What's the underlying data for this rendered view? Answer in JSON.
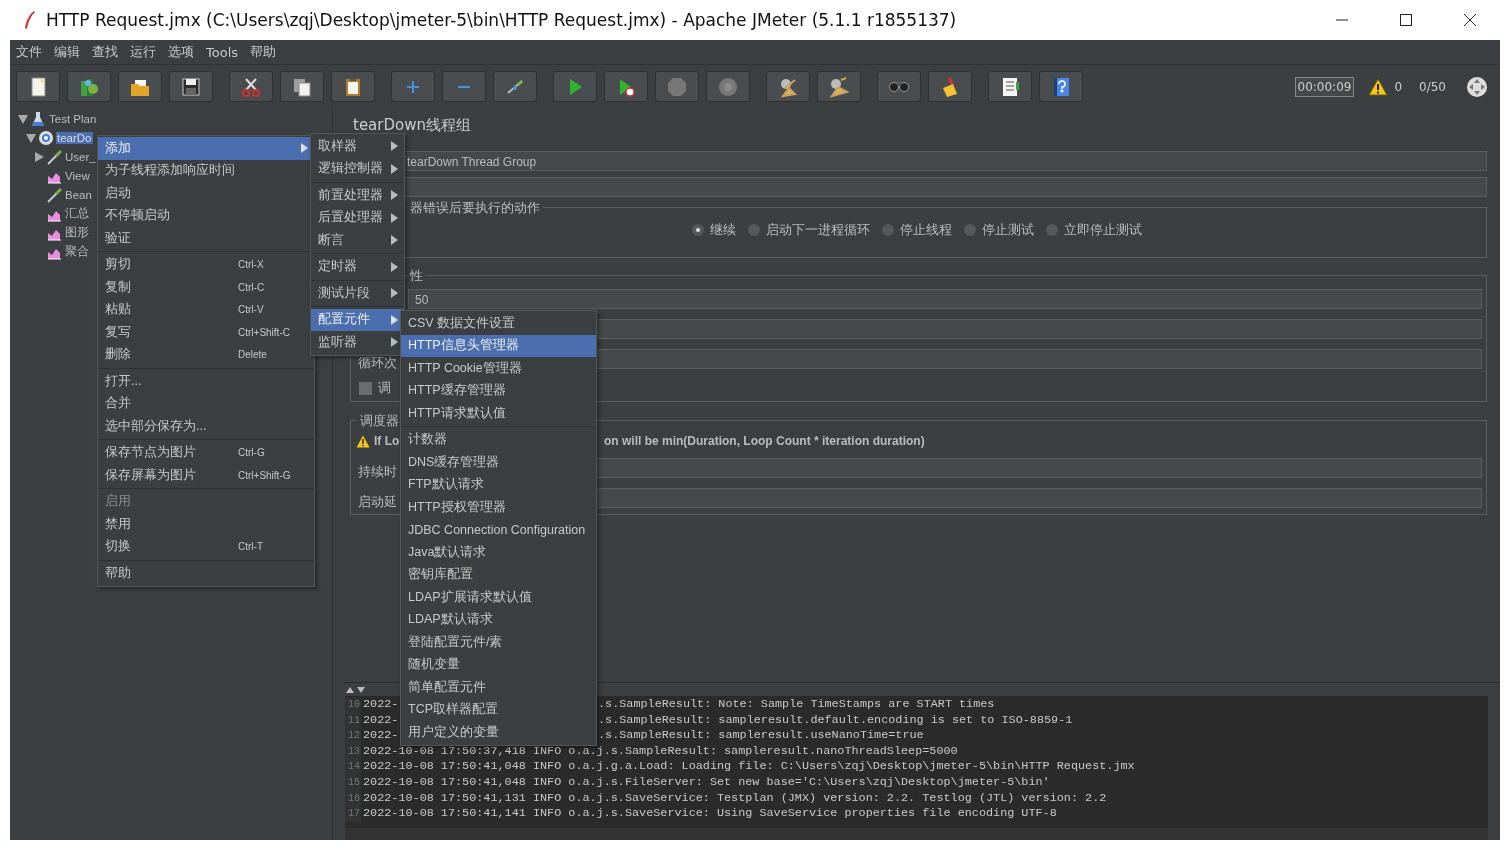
{
  "window": {
    "title": "HTTP Request.jmx (C:\\Users\\zqj\\Desktop\\jmeter-5\\bin\\HTTP Request.jmx) - Apache JMeter (5.1.1 r1855137)"
  },
  "menubar": [
    "文件",
    "编辑",
    "查找",
    "运行",
    "选项",
    "Tools",
    "帮助"
  ],
  "status": {
    "timer": "00:00:09",
    "warnings": "0",
    "threads": "0/50"
  },
  "tree": [
    {
      "label": "Test Plan",
      "kind": "plan",
      "expanded": true,
      "selected": false,
      "children": [
        {
          "label": "tearDo",
          "kind": "thread-group",
          "expanded": true,
          "selected": true,
          "children": [
            {
              "label": "User_",
              "kind": "pipette",
              "expanded": false,
              "selected": false
            },
            {
              "label": "View",
              "kind": "graph",
              "selected": false
            },
            {
              "label": "Bean",
              "kind": "pipette",
              "selected": false
            },
            {
              "label": "汇总",
              "kind": "graph",
              "selected": false
            },
            {
              "label": "图形",
              "kind": "graph",
              "selected": false
            },
            {
              "label": "聚合",
              "kind": "graph",
              "selected": false
            }
          ]
        }
      ]
    }
  ],
  "panel": {
    "title": "tearDown线程组",
    "name_value": "tearDown Thread Group",
    "error_action": {
      "legend": "器错误后要执行的动作",
      "options": [
        {
          "label": "继续",
          "selected": true
        },
        {
          "label": "启动下一进程循环",
          "selected": false
        },
        {
          "label": "停止线程",
          "selected": false
        },
        {
          "label": "停止测试",
          "selected": false
        },
        {
          "label": "立即停止测试",
          "selected": false
        }
      ]
    },
    "thread_properties": {
      "legend": "性",
      "rows": [
        {
          "kind": "field",
          "value": "50"
        },
        {
          "kind": "field"
        },
        {
          "kind": "field",
          "label": "循环次"
        },
        {
          "kind": "checkbox",
          "label": "调",
          "checked": false
        }
      ]
    },
    "scheduler": {
      "legend": "调度器",
      "warning_start": "If Lo",
      "warning_end": "on will be min(Duration, Loop Count * iteration duration)",
      "rows": [
        {
          "kind": "field",
          "label": "持续时"
        },
        {
          "kind": "field",
          "label": "启动延"
        }
      ]
    }
  },
  "log": [
    {
      "number": "10",
      "segments": [
        "2022-",
        ".s.SampleResult: Note: Sample TimeStamps are START times"
      ]
    },
    {
      "number": "11",
      "segments": [
        "2022-",
        ".s.SampleResult: sampleresult.default.encoding is set to ISO-8859-1"
      ]
    },
    {
      "number": "12",
      "segments": [
        "2022-",
        ".s.SampleResult: sampleresult.useNanoTime=true"
      ]
    },
    {
      "number": "13",
      "segments": [
        "2022-10-08 17:50:37,418 INFO o.a.j.s.SampleResult: sampleresult.nanoThreadSleep=5000"
      ]
    },
    {
      "number": "14",
      "segments": [
        "2022-10-08 17:50:41,048 INFO o.a.j.g.a.Load: Loading file: C:\\Users\\zqj\\Desktop\\jmeter-5\\bin\\HTTP Request.jmx"
      ]
    },
    {
      "number": "15",
      "segments": [
        "2022-10-08 17:50:41,048 INFO o.a.j.s.FileServer: Set new base='C:\\Users\\zqj\\Desktop\\jmeter-5\\bin'"
      ]
    },
    {
      "number": "16",
      "segments": [
        "2022-10-08 17:50:41,131 INFO o.a.j.s.SaveService: Testplan (JMX) version: 2.2. Testlog (JTL) version: 2.2"
      ]
    },
    {
      "number": "17",
      "segments": [
        "2022-10-08 17:50:41,141 INFO o.a.j.s.SaveService: Using SaveService properties file encoding UTF-8"
      ]
    }
  ],
  "context_menu": [
    [
      {
        "label": "添加",
        "selected": true,
        "arrow": true,
        "disabled": false
      },
      {
        "label": "为子线程添加响应时间",
        "selected": false,
        "arrow": false,
        "disabled": false
      },
      {
        "label": "启动",
        "selected": false,
        "arrow": false,
        "disabled": false
      },
      {
        "label": "不停顿启动",
        "selected": false,
        "arrow": false,
        "disabled": false
      },
      {
        "label": "验证",
        "selected": false,
        "arrow": false,
        "disabled": false
      }
    ],
    [
      {
        "label": "剪切",
        "shortcut": "Ctrl-X",
        "selected": false,
        "arrow": false,
        "disabled": false
      },
      {
        "label": "复制",
        "shortcut": "Ctrl-C",
        "selected": false,
        "arrow": false,
        "disabled": false
      },
      {
        "label": "粘贴",
        "shortcut": "Ctrl-V",
        "selected": false,
        "arrow": false,
        "disabled": false
      },
      {
        "label": "复写",
        "shortcut": "Ctrl+Shift-C",
        "selected": false,
        "arrow": false,
        "disabled": false
      },
      {
        "label": "删除",
        "shortcut": "Delete",
        "selected": false,
        "arrow": false,
        "disabled": false
      }
    ],
    [
      {
        "label": "打开...",
        "selected": false,
        "arrow": false,
        "disabled": false
      },
      {
        "label": "合并",
        "selected": false,
        "arrow": false,
        "disabled": false
      },
      {
        "label": "选中部分保存为...",
        "selected": false,
        "arrow": false,
        "disabled": false
      }
    ],
    [
      {
        "label": "保存节点为图片",
        "shortcut": "Ctrl-G",
        "selected": false,
        "arrow": false,
        "disabled": false
      },
      {
        "label": "保存屏幕为图片",
        "shortcut": "Ctrl+Shift-G",
        "selected": false,
        "arrow": false,
        "disabled": false
      }
    ],
    [
      {
        "label": "启用",
        "selected": false,
        "arrow": false,
        "disabled": true
      },
      {
        "label": "禁用",
        "selected": false,
        "arrow": false,
        "disabled": false
      },
      {
        "label": "切换",
        "shortcut": "Ctrl-T",
        "selected": false,
        "arrow": false,
        "disabled": false
      }
    ],
    [
      {
        "label": "帮助",
        "selected": false,
        "arrow": false,
        "disabled": false
      }
    ]
  ],
  "add_submenu": [
    [
      {
        "label": "取样器",
        "selected": false,
        "arrow": true
      },
      {
        "label": "逻辑控制器",
        "selected": false,
        "arrow": true
      }
    ],
    [
      {
        "label": "前置处理器",
        "selected": false,
        "arrow": true
      },
      {
        "label": "后置处理器",
        "selected": false,
        "arrow": true
      },
      {
        "label": "断言",
        "selected": false,
        "arrow": true
      }
    ],
    [
      {
        "label": "定时器",
        "selected": false,
        "arrow": true
      }
    ],
    [
      {
        "label": "测试片段",
        "selected": false,
        "arrow": true
      }
    ],
    [
      {
        "label": "配置元件",
        "selected": true,
        "arrow": true
      },
      {
        "label": "监听器",
        "selected": false,
        "arrow": true
      }
    ]
  ],
  "config_submenu": [
    [
      {
        "label": "CSV 数据文件设置",
        "selected": false
      },
      {
        "label": "HTTP信息头管理器",
        "selected": true
      },
      {
        "label": "HTTP Cookie管理器",
        "selected": false
      },
      {
        "label": "HTTP缓存管理器",
        "selected": false
      },
      {
        "label": "HTTP请求默认值",
        "selected": false
      }
    ],
    [
      {
        "label": "计数器",
        "selected": false
      },
      {
        "label": "DNS缓存管理器",
        "selected": false
      },
      {
        "label": "FTP默认请求",
        "selected": false
      },
      {
        "label": "HTTP授权管理器",
        "selected": false
      },
      {
        "label": "JDBC Connection Configuration",
        "selected": false
      },
      {
        "label": "Java默认请求",
        "selected": false
      },
      {
        "label": "密钥库配置",
        "selected": false
      },
      {
        "label": "LDAP扩展请求默认值",
        "selected": false
      },
      {
        "label": "LDAP默认请求",
        "selected": false
      },
      {
        "label": "登陆配置元件/素",
        "selected": false
      },
      {
        "label": "随机变量",
        "selected": false
      },
      {
        "label": "简单配置元件",
        "selected": false
      },
      {
        "label": "TCP取样器配置",
        "selected": false
      },
      {
        "label": "用户定义的变量",
        "selected": false
      }
    ]
  ]
}
